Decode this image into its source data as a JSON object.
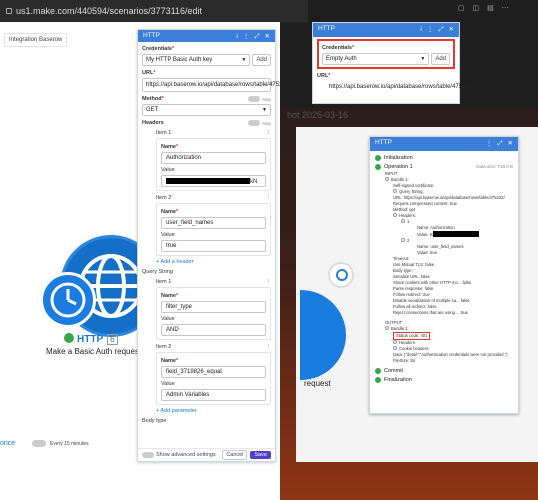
{
  "browser": {
    "url": "us1.make.com/440594/scenarios/3773116/edit"
  },
  "canvas": {
    "integration_tag": "Integration Baserow",
    "module_title": "HTTP",
    "module_number": "6",
    "module_subtitle": "Make a Basic Auth request",
    "run_once": "once",
    "schedule": "Every 15 minutes"
  },
  "panel": {
    "title": "HTTP",
    "credentials_label": "Credentials",
    "credentials_value": "My HTTP Basic Auth key",
    "add_label": "Add",
    "url_label": "URL",
    "url_value": "https://api.baserow.io/api/database/rows/table/475222/",
    "method_label": "Method",
    "method_value": "GET",
    "map_label": "Map",
    "headers_label": "Headers",
    "item1_label": "Item 1",
    "item2_label": "Item 2",
    "name_label": "Name",
    "value_label": "Value",
    "h1_name": "Authorization",
    "h1_value_tail": "kN",
    "h2_name": "user_field_names",
    "h2_value": "true",
    "add_header": "+ Add a header",
    "qs_label": "Query String",
    "q1_name": "filter_type",
    "q1_value": "AND",
    "q2_name": "field_3719826_equal",
    "q2_value": "Admin Variables",
    "add_param": "+ Add parameter",
    "body_type": "Body type",
    "show_adv": "Show advanced settings",
    "cancel": "Cancel",
    "save": "Save"
  },
  "mini": {
    "title": "HTTP",
    "credentials_label": "Credentials",
    "credentials_value": "Empty Auth",
    "add_label": "Add",
    "url_label": "URL",
    "url_value": "https://api.baserow.io/api/database/rows/table/475222/"
  },
  "dark": {
    "title_fragment": "hot 2025-03-16",
    "request": "request"
  },
  "log": {
    "title": "HTTP",
    "initialization": "Initialization",
    "operation": "Operation 1",
    "data_size": "Data size: 718.0 B",
    "input": "INPUT",
    "bundle1": "Bundle 1:",
    "self_signed": "Self-signed certificate:",
    "query_string": "Query String:",
    "url_line": "URL: https://api.baserow.io/api/database/rows/table/475222/",
    "req_comp": "Request compressed content: true",
    "method": "Method: get",
    "headers": "Headers:",
    "h1": "1",
    "h1_name": "Name: Authorization",
    "h1_value": "Value: Ki",
    "h2": "2",
    "h2_name": "Name: user_field_names",
    "h2_value": "Value: true",
    "timeout": "Timeout:",
    "mutual": "Use Mutual TLS: false",
    "body_type": "Body type:",
    "serialize": "Serialize URL: false",
    "share_cookies": "Share cookies with other HTTP mo... false",
    "parse": "Parse response: false",
    "follow": "Follow redirect: true",
    "disable_ser": "Disable serialization of multiple sa... false",
    "follow_all": "Follow all redirect: false",
    "reject": "Reject connections that are using ... true",
    "output": "OUTPUT",
    "out_bundle": "Bundle 1:",
    "status": "Status code: 401",
    "out_headers": "Headers:",
    "cookie_headers": "Cookie headers:",
    "data": "Data: {\"detail\":\"Authentication credentials were not provided.\"}",
    "filesize": "FileSize: 58",
    "commit": "Commit",
    "finalization": "Finalization"
  }
}
